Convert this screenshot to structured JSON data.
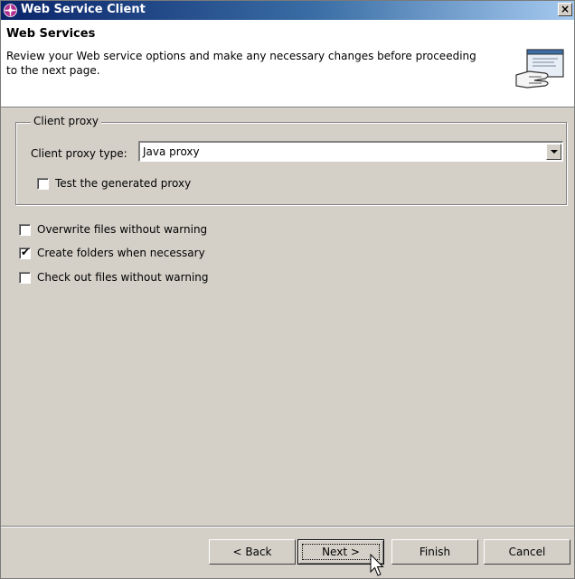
{
  "window": {
    "title": "Web Service Client",
    "close_glyph": "×"
  },
  "header": {
    "title": "Web Services",
    "description": "Review your Web service options and make any necessary changes before proceeding to the next page."
  },
  "client_proxy": {
    "group_label": "Client proxy",
    "type_label": "Client proxy type:",
    "type_value": "Java proxy",
    "test_proxy": {
      "label": "Test the generated proxy",
      "checked": false
    }
  },
  "options": [
    {
      "label": "Overwrite files without warning",
      "checked": false
    },
    {
      "label": "Create folders when necessary",
      "checked": true
    },
    {
      "label": "Check out files without warning",
      "checked": false
    }
  ],
  "buttons": {
    "back": "< Back",
    "next": "Next >",
    "finish": "Finish",
    "cancel": "Cancel"
  },
  "icons": {
    "app": "web-service-icon",
    "header": "hand-screen-icon"
  }
}
